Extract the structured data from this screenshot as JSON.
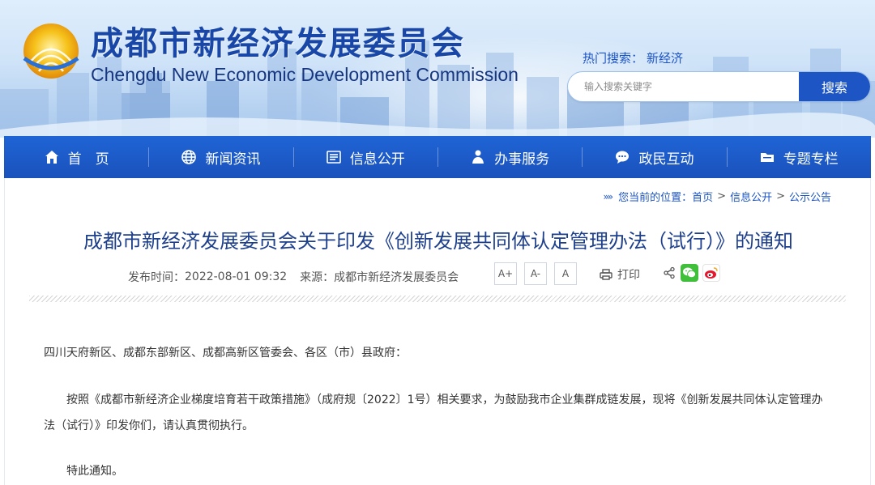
{
  "site": {
    "title_cn": "成都市新经济发展委员会",
    "title_en": "Chengdu New Economic Development Commission",
    "hot_search_label": "热门搜索：",
    "hot_search_term": "新经济",
    "search_placeholder": "输入搜索关键字",
    "search_button": "搜索"
  },
  "nav": {
    "items": [
      {
        "label": "首　页",
        "icon": "home-icon"
      },
      {
        "label": "新闻资讯",
        "icon": "globe-icon"
      },
      {
        "label": "信息公开",
        "icon": "document-icon"
      },
      {
        "label": "办事服务",
        "icon": "person-icon"
      },
      {
        "label": "政民互动",
        "icon": "chat-icon"
      },
      {
        "label": "专题专栏",
        "icon": "folder-icon"
      }
    ]
  },
  "breadcrumb": {
    "prefix": "您当前的位置：",
    "items": [
      "首页",
      "信息公开",
      "公示公告"
    ],
    "sep": ">"
  },
  "article": {
    "title": "成都市新经济发展委员会关于印发《创新发展共同体认定管理办法（试行）》的通知",
    "publish_label": "发布时间：",
    "publish_time": "2022-08-01 09:32",
    "source_label": "来源：",
    "source": "成都市新经济发展委员会",
    "font_buttons": [
      "A+",
      "A-",
      "A"
    ],
    "print_label": "打印",
    "salutation": "四川天府新区、成都东部新区、成都高新区管委会、各区（市）县政府：",
    "paragraph1": "按照《成都市新经济企业梯度培育若干政策措施》（成府规〔2022〕1号）相关要求，为鼓励我市企业集群成链发展，现将《创新发展共同体认定管理办法（试行）》印发你们，请认真贯彻执行。",
    "closing": "特此通知。"
  },
  "colors": {
    "brand_blue": "#1a52bb",
    "title_blue": "#1d3f8c",
    "link_blue": "#1b54c6"
  }
}
